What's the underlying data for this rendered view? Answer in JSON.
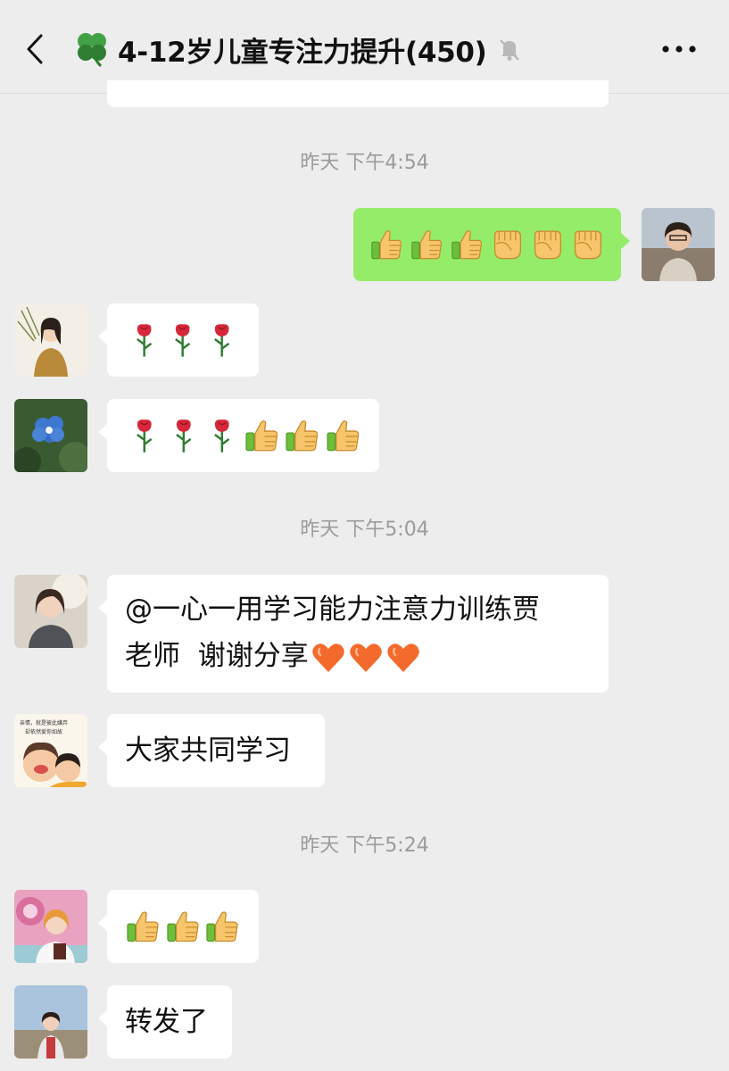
{
  "header": {
    "title": "4-12岁儿童专注力提升(450)",
    "back_icon": "chevron-left-icon",
    "group_icon": "four-leaf-clover-icon",
    "mute_icon": "bell-muted-icon",
    "more_icon": "ellipsis-icon"
  },
  "colors": {
    "background": "#ededed",
    "self_bubble": "#95ec69",
    "other_bubble": "#ffffff",
    "timestamp": "#9b9b9b"
  },
  "timestamps": [
    "昨天 下午4:54",
    "昨天 下午5:04",
    "昨天 下午5:24"
  ],
  "messages": [
    {
      "side": "right",
      "type": "emoji",
      "content": [
        "thumbs-up",
        "thumbs-up",
        "thumbs-up",
        "fist",
        "fist",
        "fist"
      ]
    },
    {
      "side": "left",
      "type": "emoji",
      "content": [
        "rose",
        "rose",
        "rose"
      ]
    },
    {
      "side": "left",
      "type": "emoji",
      "content": [
        "rose",
        "rose",
        "rose",
        "thumbs-up",
        "thumbs-up",
        "thumbs-up"
      ]
    },
    {
      "side": "left",
      "type": "text",
      "line1": "@一心一用学习能力注意力训练贾",
      "line2": "老师  谢谢分享",
      "trailing": [
        "heart",
        "heart",
        "heart"
      ]
    },
    {
      "side": "left",
      "type": "text",
      "text": "大家共同学习",
      "avatar_caption": "亲情，就是彼此嫌弃 却依然爱你如故"
    },
    {
      "side": "left",
      "type": "emoji",
      "content": [
        "thumbs-up",
        "thumbs-up",
        "thumbs-up"
      ]
    },
    {
      "side": "left",
      "type": "text",
      "text": "转发了"
    }
  ]
}
